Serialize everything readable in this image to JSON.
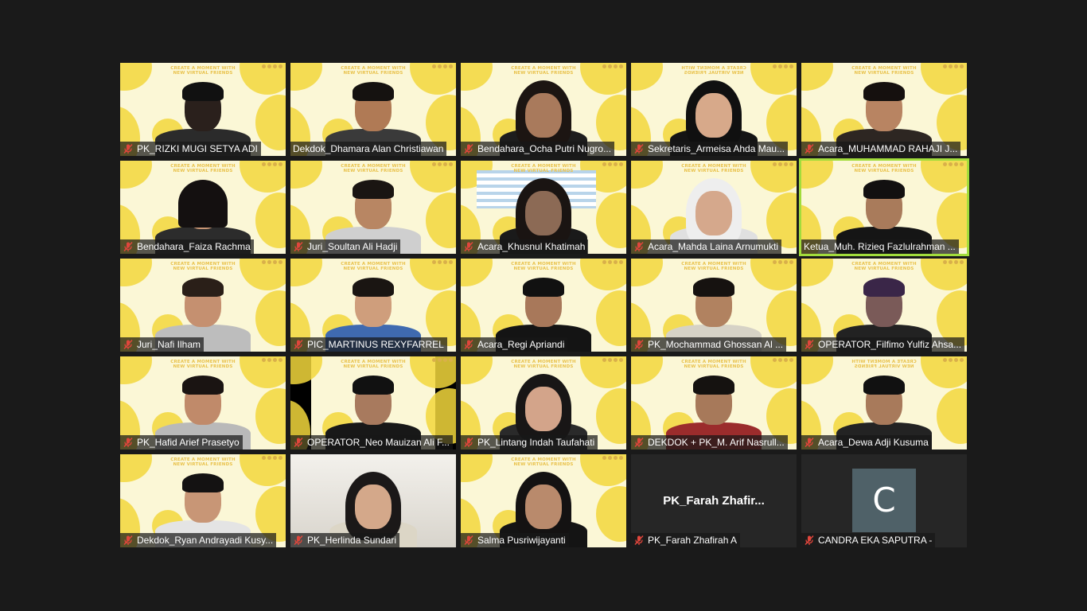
{
  "banner_text": "CREATE A MOMENT WITH NEW VIRTUAL FRIENDS",
  "participants": [
    {
      "name": "PK_RIZKI MUGI SETYA ADI",
      "muted": true
    },
    {
      "name": "Dekdok_Dhamara Alan Christiawan",
      "muted": false
    },
    {
      "name": "Bendahara_Ocha Putri Nugro...",
      "muted": true
    },
    {
      "name": "Sekretaris_Armeisa Ahda Mau...",
      "muted": true
    },
    {
      "name": "Acara_MUHAMMAD RAHAJI J...",
      "muted": true
    },
    {
      "name": "Bendahara_Faiza Rachma",
      "muted": true
    },
    {
      "name": "Juri_Soultan Ali Hadji",
      "muted": true
    },
    {
      "name": "Acara_Khusnul Khatimah",
      "muted": true
    },
    {
      "name": "Acara_Mahda Laina Arnumukti",
      "muted": true
    },
    {
      "name": "Ketua_Muh. Rizieq Fazlulrahman ...",
      "muted": false,
      "active_speaker": true
    },
    {
      "name": "Juri_Nafi Ilham",
      "muted": true
    },
    {
      "name": "PIC_MARTINUS REXYFARREL",
      "muted": true
    },
    {
      "name": "Acara_Regi Apriandi",
      "muted": true
    },
    {
      "name": "PK_Mochammad Ghossan Al ...",
      "muted": true
    },
    {
      "name": "OPERATOR_Filfimo Yulfiz Ahsa...",
      "muted": true
    },
    {
      "name": "PK_Hafid Arief Prasetyo",
      "muted": true
    },
    {
      "name": "OPERATOR_Neo Mauizan Ali F...",
      "muted": true
    },
    {
      "name": "PK_Lintang Indah Taufahati",
      "muted": true
    },
    {
      "name": "DEKDOK + PK_M. Arif Nasrull...",
      "muted": true
    },
    {
      "name": "Acara_Dewa Adji Kusuma",
      "muted": true
    },
    {
      "name": "Dekdok_Ryan Andrayadi Kusy...",
      "muted": true
    },
    {
      "name": "PK_Herlinda Sundari",
      "muted": true
    },
    {
      "name": "Salma Pusriwijayanti",
      "muted": true
    },
    {
      "name": "PK_Farah Zhafirah A",
      "muted": true,
      "video_off": true,
      "display_name": "PK_Farah  Zhafir..."
    },
    {
      "name": "CANDRA EKA SAPUTRA -",
      "muted": true,
      "video_off": true,
      "avatar_letter": "C"
    }
  ],
  "colors": {
    "background": "#1a1a1a",
    "active_speaker": "#a2dc3c",
    "muted_icon": "#e0463c",
    "avatar": "#4f6168"
  }
}
